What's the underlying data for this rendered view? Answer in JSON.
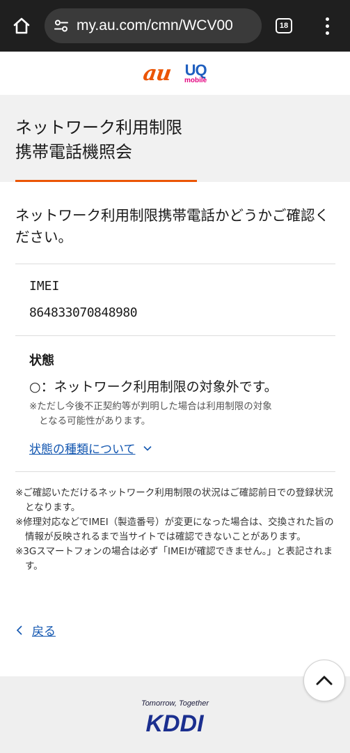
{
  "browser": {
    "url": "my.au.com/cmn/WCV00",
    "tab_count": "18"
  },
  "header": {
    "au_logo": "au",
    "uq_logo_main": "UQ",
    "uq_logo_sub": "mobile"
  },
  "page": {
    "title": "ネットワーク利用制限\n携帯電話機照会",
    "intro": "ネットワーク利用制限携帯電話かどうかご確認く\nださい。"
  },
  "imei": {
    "label": "IMEI",
    "value": "864833070848980"
  },
  "status": {
    "label": "状態",
    "value": "○：ネットワーク利用制限の対象外です。",
    "note_line1": "※ただし今後不正契約等が判明した場合は利用制限の対象",
    "note_line2": "となる可能性があります。",
    "link": "状態の種類について"
  },
  "notes": [
    "※ご確認いただけるネットワーク利用制限の状況はご確認前日での登録状況となります。",
    "※修理対応などでIMEI（製造番号）が変更になった場合は、交換された旨の情報が反映されるまで当サイトでは確認できないことがあります。",
    "※3Gスマートフォンの場合は必ず「IMEIが確認できません。」と表記されます。"
  ],
  "back_link": "戻る",
  "footer": {
    "tagline": "Tomorrow, Together",
    "brand": "KDDI"
  },
  "colors": {
    "accent": "#eb5505",
    "link": "#1256b0",
    "browser_bar": "#1f1f1f"
  },
  "icons": {
    "home": "home-icon",
    "site_settings": "site-settings-icon",
    "menu": "more-vert-icon",
    "chevron_down": "chevron-down-icon",
    "back": "chevron-left-icon",
    "scroll_top": "chevron-up-icon"
  }
}
